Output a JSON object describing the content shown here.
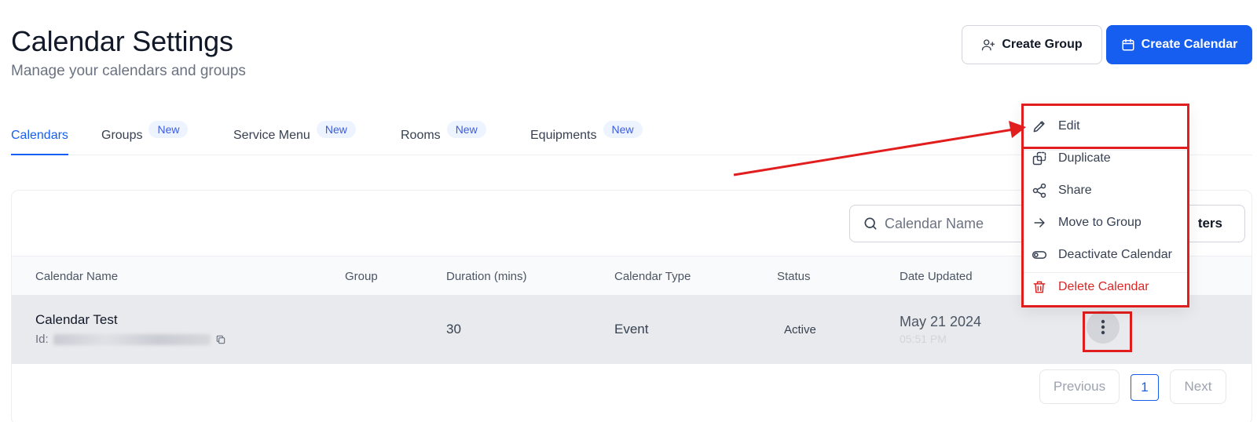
{
  "header": {
    "title": "Calendar Settings",
    "subtitle": "Manage your calendars and groups",
    "create_group": "Create Group",
    "create_calendar": "Create Calendar"
  },
  "tabs": [
    {
      "label": "Calendars",
      "badge": ""
    },
    {
      "label": "Groups",
      "badge": "New"
    },
    {
      "label": "Service Menu",
      "badge": "New"
    },
    {
      "label": "Rooms",
      "badge": "New"
    },
    {
      "label": "Equipments",
      "badge": "New"
    }
  ],
  "toolbar": {
    "search_placeholder": "Calendar Name",
    "filters_label": "ters"
  },
  "table": {
    "columns": [
      "Calendar Name",
      "Group",
      "Duration (mins)",
      "Calendar Type",
      "Status",
      "Date Updated"
    ],
    "rows": [
      {
        "name": "Calendar Test",
        "id_label": "Id:",
        "group": "",
        "duration": "30",
        "type": "Event",
        "status": "Active",
        "date": "May 21 2024",
        "time": "05:51 PM"
      }
    ]
  },
  "pagination": {
    "previous": "Previous",
    "page": "1",
    "next": "Next"
  },
  "menu": {
    "items": [
      {
        "label": "Edit",
        "icon": "pencil-icon"
      },
      {
        "label": "Duplicate",
        "icon": "duplicate-icon"
      },
      {
        "label": "Share",
        "icon": "share-icon"
      },
      {
        "label": "Move to Group",
        "icon": "arrow-right-icon"
      },
      {
        "label": "Deactivate Calendar",
        "icon": "toggle-icon"
      },
      {
        "label": "Delete Calendar",
        "icon": "trash-icon"
      }
    ]
  },
  "colors": {
    "primary": "#155eef",
    "danger": "#dc2626",
    "highlight": "#e11d1d"
  }
}
